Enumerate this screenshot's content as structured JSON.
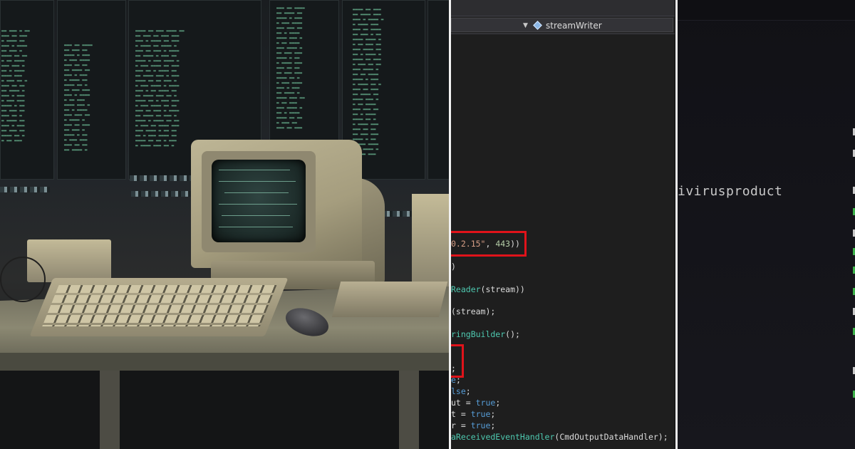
{
  "editor": {
    "nav_member": "streamWriter",
    "code_lines": [
      {
        "parts": [
          {
            "t": "0.2.15\"",
            "c": "str"
          },
          {
            "t": ", ",
            "c": ""
          },
          {
            "t": "443",
            "c": "num"
          },
          {
            "t": "))",
            "c": ""
          }
        ]
      },
      {
        "parts": [
          {
            "t": ")",
            "c": ""
          }
        ]
      },
      {
        "parts": [
          {
            "t": "Reader",
            "c": "type"
          },
          {
            "t": "(stream))",
            "c": ""
          }
        ]
      },
      {
        "parts": [
          {
            "t": "(stream);",
            "c": ""
          }
        ]
      },
      {
        "parts": [
          {
            "t": "ringBuilder",
            "c": "type"
          },
          {
            "t": "();",
            "c": ""
          }
        ]
      },
      {
        "parts": [
          {
            "t": ";",
            "c": ""
          }
        ]
      },
      {
        "parts": [
          {
            "t": "e",
            "c": "kw"
          },
          {
            "t": ";",
            "c": ""
          }
        ]
      },
      {
        "parts": [
          {
            "t": "lse",
            "c": "kw"
          },
          {
            "t": ";",
            "c": ""
          }
        ]
      },
      {
        "parts": [
          {
            "t": "ut = ",
            "c": ""
          },
          {
            "t": "true",
            "c": "kw"
          },
          {
            "t": ";",
            "c": ""
          }
        ]
      },
      {
        "parts": [
          {
            "t": "t = ",
            "c": ""
          },
          {
            "t": "true",
            "c": "kw"
          },
          {
            "t": ";",
            "c": ""
          }
        ]
      },
      {
        "parts": [
          {
            "t": "r = ",
            "c": ""
          },
          {
            "t": "true",
            "c": "kw"
          },
          {
            "t": ";",
            "c": ""
          }
        ]
      },
      {
        "parts": [
          {
            "t": "aReceivedEventHandler",
            "c": "type"
          },
          {
            "t": "(CmdOutputDataHandler);",
            "c": ""
          }
        ]
      }
    ]
  },
  "terminal": {
    "visible_text": "ivirusproduct"
  },
  "colors": {
    "highlight_box": "#e0131a",
    "code_keyword": "#569cd6",
    "code_type": "#4ec9b0",
    "code_number": "#b5cea8",
    "code_string": "#d69d85",
    "terminal_green": "#3eb24a"
  }
}
